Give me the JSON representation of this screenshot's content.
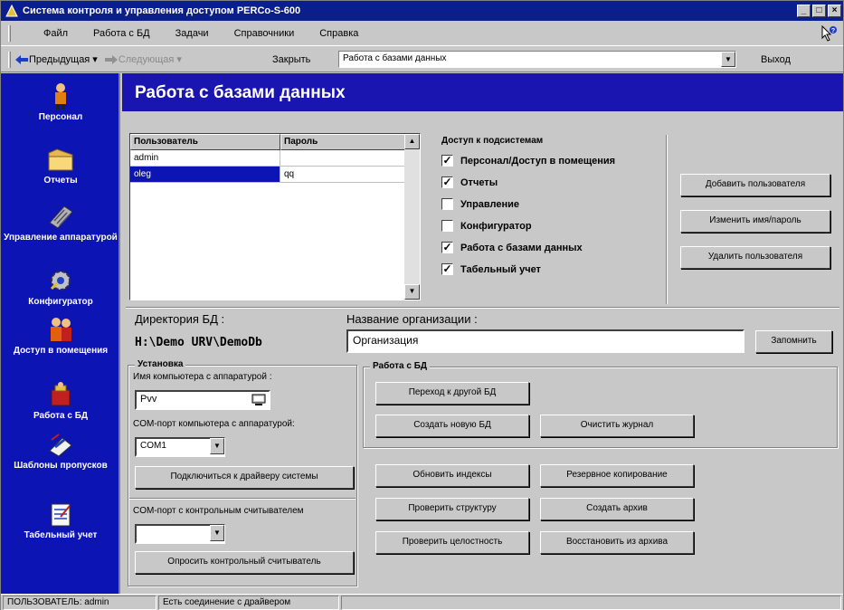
{
  "window": {
    "title": "Система контроля и управления доступом PERCo-S-600"
  },
  "menu": {
    "items": [
      "Файл",
      "Работа с БД",
      "Задачи",
      "Справочники",
      "Справка"
    ]
  },
  "toolbar": {
    "back_label": "Предыдущая",
    "forward_label": "Следующая",
    "close_label": "Закрыть",
    "page_select_value": "Работа с базами данных",
    "exit_label": "Выход"
  },
  "sidebar": {
    "items": [
      {
        "label": "Персонал",
        "icon": "person-icon"
      },
      {
        "label": "Отчеты",
        "icon": "folder-icon"
      },
      {
        "label": "Управление аппаратурой",
        "icon": "keyboard-icon"
      },
      {
        "label": "Конфигуратор",
        "icon": "gear-icon"
      },
      {
        "label": "Доступ в помещения",
        "icon": "people-icon"
      },
      {
        "label": "Работа с БД",
        "icon": "database-icon"
      },
      {
        "label": "Шаблоны пропусков",
        "icon": "pass-template-icon"
      },
      {
        "label": "Табельный учет",
        "icon": "timesheet-icon"
      }
    ]
  },
  "header": {
    "title": "Работа с базами данных"
  },
  "users_table": {
    "columns": [
      "Пользователь",
      "Пароль"
    ],
    "rows": [
      {
        "user": "admin",
        "password": ""
      },
      {
        "user": "oleg",
        "password": "qq"
      }
    ],
    "selected_row": 1
  },
  "access": {
    "title": "Доступ к подсистемам",
    "items": [
      {
        "label": "Персонал/Доступ в помещения",
        "checked": true
      },
      {
        "label": "Отчеты",
        "checked": true
      },
      {
        "label": "Управление",
        "checked": false
      },
      {
        "label": "Конфигуратор",
        "checked": false
      },
      {
        "label": "Работа с базами данных",
        "checked": true
      },
      {
        "label": "Табельный учет",
        "checked": true
      }
    ],
    "checkmark": "✓"
  },
  "user_buttons": {
    "add": "Добавить пользователя",
    "edit": "Изменить имя/пароль",
    "delete": "Удалить пользователя"
  },
  "db": {
    "dir_label": "Директория БД :",
    "dir_value": "H:\\Demo URV\\DemoDb",
    "org_label": "Название организации :",
    "org_value": "Организация",
    "remember_button": "Запомнить"
  },
  "setup": {
    "title": "Установка",
    "computer_label": "Имя компьютера с аппаратурой :",
    "computer_value": "Pvv",
    "com_label": "COM-порт компьютера с аппаратурой:",
    "com_value": "COM1",
    "connect_button": "Подключиться к драйверу системы",
    "reader_com_label": "COM-порт с контрольным считывателем",
    "reader_com_value": "",
    "poll_button": "Опросить контрольный считыватель"
  },
  "db_ops": {
    "title": "Работа с БД",
    "goto_other": "Переход к другой БД",
    "create_new": "Создать новую БД",
    "clear_log": "Очистить журнал",
    "update_indexes": "Обновить индексы",
    "backup": "Резервное копирование",
    "check_structure": "Проверить структуру",
    "create_archive": "Создать архив",
    "check_integrity": "Проверить целостность",
    "restore_archive": "Восстановить из архива"
  },
  "status": {
    "user": "ПОЛЬЗОВАТЕЛЬ: admin",
    "connection": "Есть соединение с драйвером"
  }
}
